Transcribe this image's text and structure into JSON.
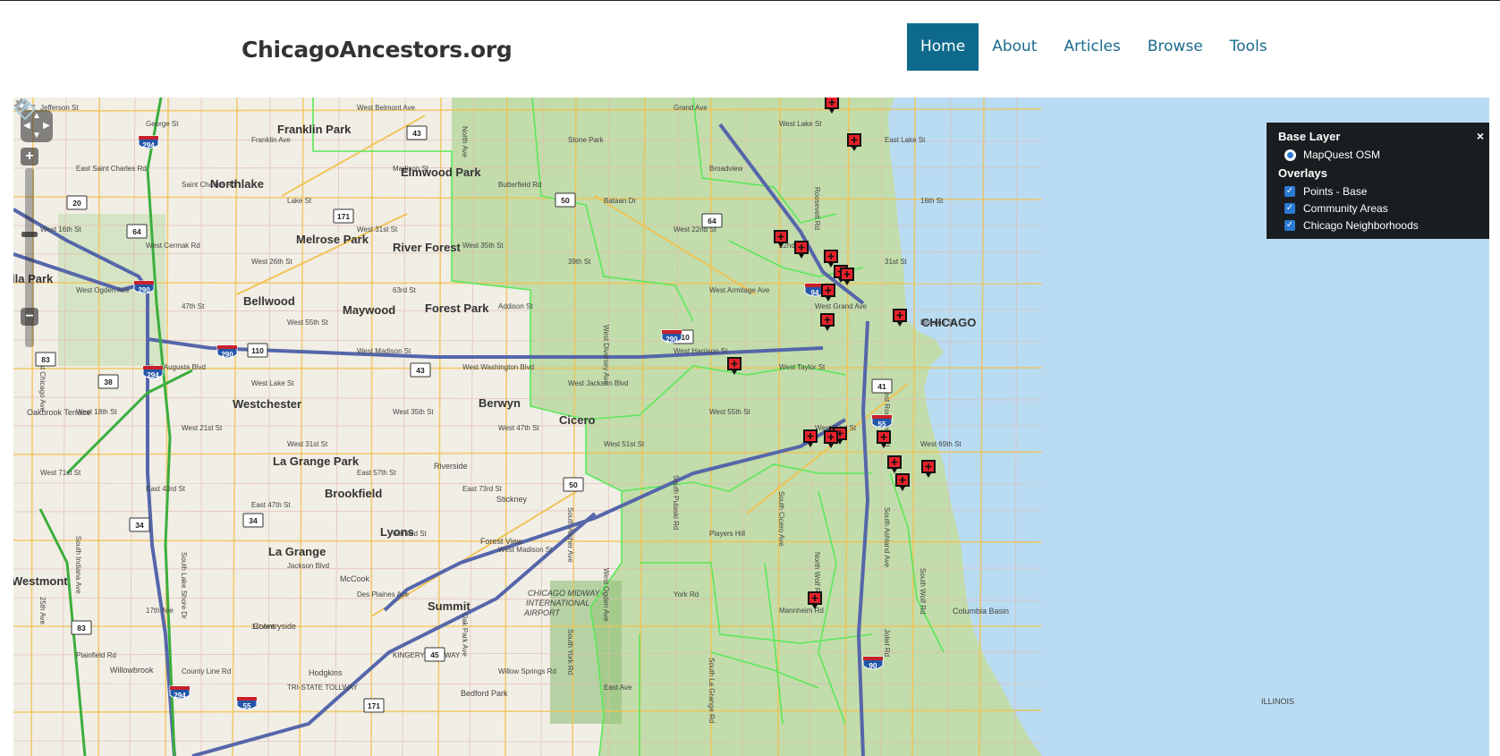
{
  "site": {
    "title": "ChicagoAncestors.org"
  },
  "nav": [
    {
      "label": "Home",
      "active": true
    },
    {
      "label": "About",
      "active": false
    },
    {
      "label": "Articles",
      "active": false
    },
    {
      "label": "Browse",
      "active": false
    },
    {
      "label": "Tools",
      "active": false
    }
  ],
  "map": {
    "layer_switcher": {
      "base_title": "Base Layer",
      "base_layer": "MapQuest OSM",
      "overlays_title": "Overlays",
      "overlays": [
        "Points - Base",
        "Community Areas",
        "Chicago Neighborhoods"
      ],
      "close_glyph": "×"
    },
    "city_label": "CHICAGO",
    "place_labels": [
      "Franklin Park",
      "Elmwood Park",
      "Northlake",
      "Melrose Park",
      "River Forest",
      "Bellwood",
      "Maywood",
      "Forest Park",
      "Westchester",
      "Berwyn",
      "Cicero",
      "La Grange Park",
      "Brookfield",
      "Lyons",
      "La Grange",
      "Summit",
      "Westmont",
      "lla Park",
      "Riverside",
      "Stickney",
      "Forest View",
      "Countryside",
      "Hodgkins",
      "Willowbrook",
      "Oakbrook Terrace",
      "McCook",
      "Bedford Park",
      "CHICAGO MIDWAY INTERNATIONAL AIRPORT",
      "Columbia Basin",
      "ILLINOIS"
    ],
    "street_labels": [
      "Jefferson St",
      "George St",
      "Franklin Ave",
      "West Belmont Ave",
      "North Ave",
      "Stone Park",
      "Grand Ave",
      "West Lake St",
      "East Lake St",
      "East Saint Charles Rd",
      "Saint Charles Rd",
      "Lake St",
      "Madison St",
      "Butterfield Rd",
      "Bataan Dr",
      "Broadview",
      "Roosevelt Rd",
      "16th St",
      "West 16th St",
      "West Cermak Rd",
      "West 26th St",
      "West 31st St",
      "West 35th St",
      "39th St",
      "West 22nd St",
      "22nd St",
      "31st St",
      "West Ogden Ave",
      "47th St",
      "West 55th St",
      "63rd St",
      "Addison St",
      "West Diversey Ave",
      "West Armitage Ave",
      "West Grand Ave",
      "Division St",
      "West Chicago Ave",
      "West Augusta Blvd",
      "West Lake St",
      "West Madison St",
      "West Washington Blvd",
      "West Jackson Blvd",
      "West Harrison St",
      "West Taylor St",
      "West Roosevelt Rd",
      "West 18th St",
      "West 21st St",
      "West 31st St",
      "West 35th St",
      "West 47th St",
      "West 51st St",
      "West 55th St",
      "West 63rd St",
      "West 69th St",
      "West 71st St",
      "East 43rd St",
      "East 47th St",
      "East 57th St",
      "East 73rd St",
      "South Archer Ave",
      "South Pulaski Rd",
      "South Cicero Ave",
      "South Ashland Ave",
      "South Indiana Ave",
      "South Lake Shore Dr",
      "Jackson Blvd",
      "Garfield St",
      "West Madison St",
      "West Ogden Ave",
      "Players Hill",
      "North Wolf Rd",
      "South Wolf Rd",
      "25th Ave",
      "17th Ave",
      "1st Ave",
      "Des Plaines Ave",
      "Oak Park Ave",
      "South York Rd",
      "York Rd",
      "Mannheim Rd",
      "Joliet Rd",
      "Plainfield Rd",
      "County Line Rd",
      "TRI-STATE TOLLWAY",
      "KINGERY HIGHWAY",
      "Willow Springs Rd",
      "East Ave",
      "South La Grange Rd"
    ],
    "route_shields": [
      "294",
      "290",
      "294",
      "294",
      "55",
      "20",
      "64",
      "171",
      "110",
      "110",
      "290",
      "50",
      "43",
      "43",
      "38",
      "34",
      "34",
      "83",
      "83",
      "50",
      "45",
      "171",
      "64",
      "41",
      "94",
      "90",
      "55",
      "290"
    ],
    "marker_count": 20
  }
}
